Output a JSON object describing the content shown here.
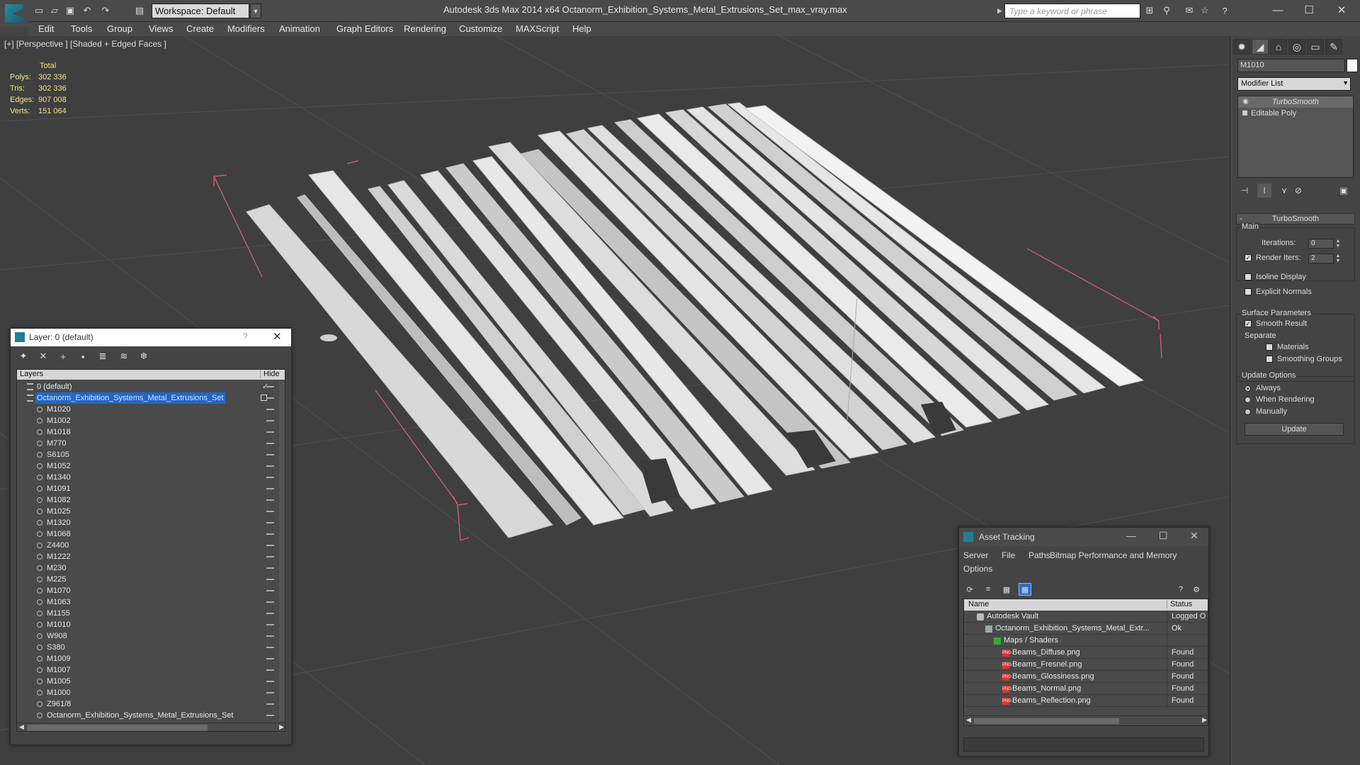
{
  "titlebar": {
    "workspace": "Workspace: Default",
    "app_title": "Autodesk 3ds Max  2014 x64      Octanorm_Exhibition_Systems_Metal_Extrusions_Set_max_vray.max",
    "search_placeholder": "Type a keyword or phrase"
  },
  "menubar": [
    "Edit",
    "Tools",
    "Group",
    "Views",
    "Create",
    "Modifiers",
    "Animation",
    "Graph Editors",
    "Rendering",
    "Customize",
    "MAXScript",
    "Help"
  ],
  "viewport": {
    "label": "[+] [Perspective ] [Shaded + Edged Faces ]",
    "stats_header": "Total",
    "stats": [
      {
        "label": "Polys:",
        "value": "302 336"
      },
      {
        "label": "Tris:",
        "value": "302 336"
      },
      {
        "label": "Edges:",
        "value": "907 008"
      },
      {
        "label": "Verts:",
        "value": "151 064"
      }
    ]
  },
  "command_panel": {
    "object_name": "M1010",
    "modifier_list": "Modifier List",
    "stack": [
      "TurboSmooth",
      "Editable Poly"
    ],
    "rollout_title": "TurboSmooth",
    "main_group": "Main",
    "iterations_label": "Iterations:",
    "iterations_value": "0",
    "render_iters_label": "Render Iters:",
    "render_iters_value": "2",
    "isoline_display": "Isoline Display",
    "explicit_normals": "Explicit Normals",
    "surface_group": "Surface Parameters",
    "smooth_result": "Smooth Result",
    "separate_label": "Separate",
    "materials": "Materials",
    "smoothing_groups": "Smoothing Groups",
    "update_group": "Update Options",
    "always": "Always",
    "when_rendering": "When Rendering",
    "manually": "Manually",
    "update_button": "Update"
  },
  "layer_window": {
    "title": "Layer: 0 (default)",
    "help": "?",
    "col_layers": "Layers",
    "col_hide": "Hide",
    "layers": [
      {
        "name": "0 (default)",
        "kind": "layer",
        "indent": 0
      },
      {
        "name": "Octanorm_Exhibition_Systems_Metal_Extrusions_Set",
        "kind": "layer",
        "indent": 0,
        "selected": true
      },
      {
        "name": "M1020",
        "kind": "object",
        "indent": 1
      },
      {
        "name": "M1002",
        "kind": "object",
        "indent": 1
      },
      {
        "name": "M1018",
        "kind": "object",
        "indent": 1
      },
      {
        "name": "M770",
        "kind": "object",
        "indent": 1
      },
      {
        "name": "S6105",
        "kind": "object",
        "indent": 1
      },
      {
        "name": "M1052",
        "kind": "object",
        "indent": 1
      },
      {
        "name": "M1340",
        "kind": "object",
        "indent": 1
      },
      {
        "name": "M1091",
        "kind": "object",
        "indent": 1
      },
      {
        "name": "M1082",
        "kind": "object",
        "indent": 1
      },
      {
        "name": "M1025",
        "kind": "object",
        "indent": 1
      },
      {
        "name": "M1320",
        "kind": "object",
        "indent": 1
      },
      {
        "name": "M1068",
        "kind": "object",
        "indent": 1
      },
      {
        "name": "Z4400",
        "kind": "object",
        "indent": 1
      },
      {
        "name": "M1222",
        "kind": "object",
        "indent": 1
      },
      {
        "name": "M230",
        "kind": "object",
        "indent": 1
      },
      {
        "name": "M225",
        "kind": "object",
        "indent": 1
      },
      {
        "name": "M1070",
        "kind": "object",
        "indent": 1
      },
      {
        "name": "M1063",
        "kind": "object",
        "indent": 1
      },
      {
        "name": "M1155",
        "kind": "object",
        "indent": 1
      },
      {
        "name": "M1010",
        "kind": "object",
        "indent": 1
      },
      {
        "name": "W908",
        "kind": "object",
        "indent": 1
      },
      {
        "name": "S380",
        "kind": "object",
        "indent": 1
      },
      {
        "name": "M1009",
        "kind": "object",
        "indent": 1
      },
      {
        "name": "M1007",
        "kind": "object",
        "indent": 1
      },
      {
        "name": "M1005",
        "kind": "object",
        "indent": 1
      },
      {
        "name": "M1000",
        "kind": "object",
        "indent": 1
      },
      {
        "name": "Z961/8",
        "kind": "object",
        "indent": 1
      },
      {
        "name": "Octanorm_Exhibition_Systems_Metal_Extrusions_Set",
        "kind": "object",
        "indent": 1
      }
    ]
  },
  "asset_window": {
    "title": "Asset Tracking",
    "menu": [
      "Server",
      "File",
      "Paths",
      "Bitmap Performance and Memory",
      "Options"
    ],
    "col_name": "Name",
    "col_status": "Status",
    "rows": [
      {
        "name": "Autodesk Vault",
        "status": "Logged O",
        "icon": "vault",
        "indent": 1
      },
      {
        "name": "Octanorm_Exhibition_Systems_Metal_Extr...",
        "status": "Ok",
        "icon": "max",
        "indent": 2
      },
      {
        "name": "Maps / Shaders",
        "status": "",
        "icon": "folder",
        "indent": 3
      },
      {
        "name": "Beams_Diffuse.png",
        "status": "Found",
        "icon": "png",
        "indent": 4
      },
      {
        "name": "Beams_Fresnel.png",
        "status": "Found",
        "icon": "png",
        "indent": 4
      },
      {
        "name": "Beams_Glossiness.png",
        "status": "Found",
        "icon": "png",
        "indent": 4
      },
      {
        "name": "Beams_Normal.png",
        "status": "Found",
        "icon": "png",
        "indent": 4
      },
      {
        "name": "Beams_Reflection.png",
        "status": "Found",
        "icon": "png",
        "indent": 4
      }
    ]
  },
  "colors": {
    "stats_text": "#f0e58a",
    "selection": "#2766c7",
    "bbox": "#e0607a",
    "extrusion": "#e8e8e8"
  }
}
